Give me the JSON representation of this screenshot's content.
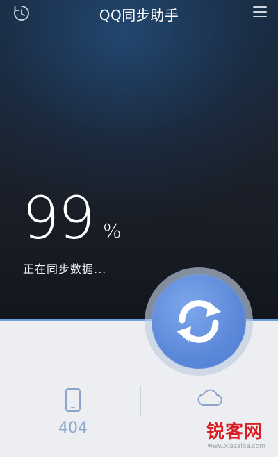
{
  "header": {
    "title": "QQ同步助手",
    "left_icon": "history-clock-icon",
    "right_icon": "hamburger-menu-icon"
  },
  "progress": {
    "value": "99",
    "unit": "%",
    "fraction": 0.99,
    "status": "正在同步数据..."
  },
  "sync_button": {
    "icon": "sync-refresh-icon",
    "color": "#5c88d9"
  },
  "stats": {
    "local": {
      "icon": "phone-icon",
      "value": "404"
    },
    "cloud": {
      "icon": "cloud-icon",
      "value": ""
    }
  },
  "watermark": {
    "text": "锐客网",
    "url": "www.xiazaiba.com"
  },
  "colors": {
    "accent": "#6e9ede",
    "stat_text": "#8aa6cf",
    "bottom_bg": "#eceef1"
  }
}
